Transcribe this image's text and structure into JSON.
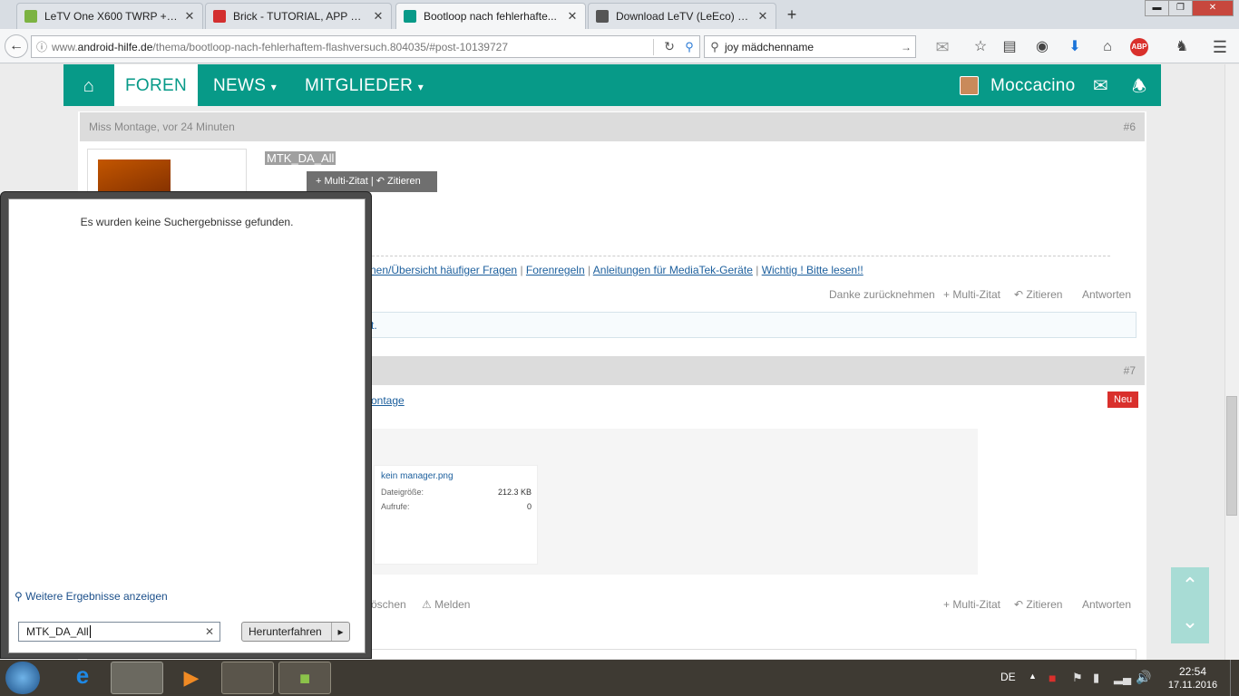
{
  "browser": {
    "tabs": [
      {
        "title": "LeTV One X600 TWRP + R...",
        "icon_color": "#7cb342",
        "active": false
      },
      {
        "title": "Brick - TUTORIAL, APP & T...",
        "icon_color": "#d32f2f",
        "active": false
      },
      {
        "title": "Bootloop nach fehlerhafte...",
        "icon_color": "#079a88",
        "active": true
      },
      {
        "title": "Download LeTV (LeEco) St...",
        "icon_color": "#555555",
        "active": false
      }
    ],
    "close_glyph": "✕",
    "newtab_glyph": "+",
    "window_controls": {
      "minimize": "▬",
      "maximize": "❐",
      "close": "✕"
    },
    "url": {
      "prefix": "www.",
      "domain": "android-hilfe.de",
      "path": "/thema/bootloop-nach-fehlerhaftem-flashversuch.804035/#post-10139727"
    },
    "search_value": "joy mädchenname",
    "toolbar_icons": [
      "mail-icon",
      "star-icon",
      "reading-list-icon",
      "pocket-icon",
      "download-icon",
      "home-icon",
      "adblock-icon",
      "extension-icon",
      "menu-icon"
    ]
  },
  "forum_nav": {
    "home_icon": "home-icon",
    "items": [
      "FOREN",
      "NEWS",
      "MITGLIEDER"
    ],
    "username": "Moccacino",
    "caret": "▾"
  },
  "post6": {
    "header": "Miss Montage, vor 24 Minuten",
    "number": "#6",
    "selected_text": "MTK_DA_All",
    "tooltip": {
      "multi": "+ Multi-Zitat",
      "sep": "|",
      "quote": "Zitieren"
    },
    "sig_links": [
      "nen/Übersicht häufiger Fragen",
      "Forenregeln",
      "Anleitungen für MediaTek-Geräte",
      "Wichtig ! Bitte lesen!!"
    ],
    "sig_sep": "|",
    "actions": [
      "Danke zurücknehmen",
      "+ Multi-Zitat",
      "Zitieren",
      "Antworten"
    ],
    "notice_tail": "t."
  },
  "post7": {
    "number": "#7",
    "author_link": "ontage",
    "badge": "Neu",
    "attachment": {
      "filename": "kein manager.png",
      "size_label": "Dateigröße:",
      "size_value": "212.3 KB",
      "views_label": "Aufrufe:",
      "views_value": "0"
    },
    "actions_left": [
      "öschen",
      "Melden"
    ],
    "actions_right": [
      "+ Multi-Zitat",
      "Zitieren",
      "Antworten"
    ]
  },
  "start_menu": {
    "no_results": "Es wurden keine Suchergebnisse gefunden.",
    "more_results": "Weitere Ergebnisse anzeigen",
    "search_value": "MTK_DA_All",
    "clear_glyph": "✕",
    "shutdown": "Herunterfahren",
    "arrow": "▸"
  },
  "taskbar": {
    "language": "DE",
    "time": "22:54",
    "date": "17.11.2016",
    "tray_arrow": "▲"
  },
  "colors": {
    "forum_teal": "#079a88",
    "badge_red": "#d9302c",
    "link_blue": "#1c5f9d",
    "scroll_btn": "#a8dcd5"
  }
}
